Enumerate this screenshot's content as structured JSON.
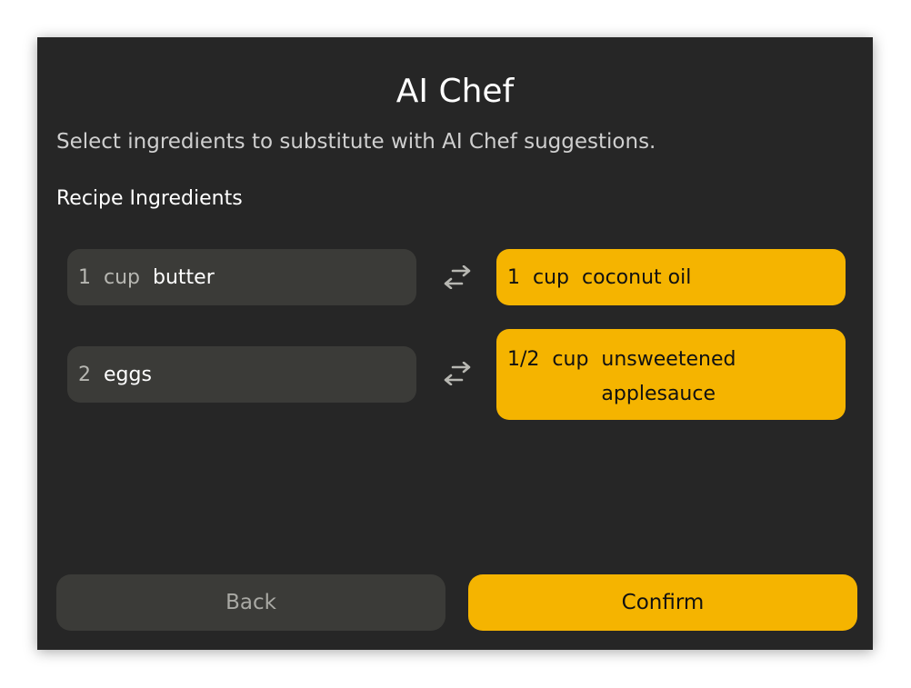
{
  "dialog": {
    "title": "AI Chef",
    "subtitle": "Select ingredients to substitute with AI Chef suggestions.",
    "section_label": "Recipe Ingredients"
  },
  "ingredients": [
    {
      "original": {
        "qty": "1",
        "unit": "cup",
        "name": "butter"
      },
      "substitute": {
        "qty": "1",
        "unit": "cup",
        "name": "coconut oil"
      }
    },
    {
      "original": {
        "qty": "2",
        "unit": "",
        "name": "eggs"
      },
      "substitute": {
        "qty": "1/2",
        "unit": "cup",
        "name": "unsweetened applesauce"
      }
    }
  ],
  "buttons": {
    "back_label": "Back",
    "confirm_label": "Confirm"
  },
  "colors": {
    "background": "#262626",
    "accent": "#f5b400",
    "pill": "#3b3b38"
  },
  "icons": {
    "swap": "swap-arrows-icon"
  }
}
